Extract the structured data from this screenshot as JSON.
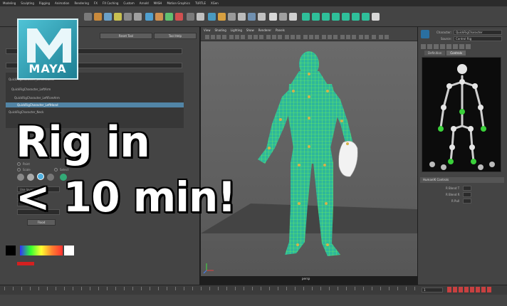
{
  "menu": {
    "items": [
      "Modeling",
      "Sculpting",
      "Rigging",
      "Animation",
      "Rendering",
      "FX",
      "FX Caching",
      "Custom",
      "Arnold",
      "MASH",
      "Motion Graphics",
      "TURTLE",
      "XGen"
    ]
  },
  "logo": {
    "word": "MAYA"
  },
  "overlay": {
    "line1": "Rig in",
    "line2": "< 10 min!"
  },
  "left_panel": {
    "reset_label": "Reset Tool",
    "help_label": "Tool Help",
    "tree": [
      "QuickRigCharacter_LeftShoulder",
      "QuickRigCharacter_LeftArm",
      "QuickRigCharacter_LeftForeArm",
      "QuickRigCharacter_LeftHand",
      "QuickRigCharacter_Neck"
    ],
    "opt_paint": "Paint",
    "opt_scale": "Scale",
    "opt_select": "Select",
    "use_layer": "Use layer",
    "flood_label": "Flood"
  },
  "viewport": {
    "menu": [
      "View",
      "Shading",
      "Lighting",
      "Show",
      "Renderer",
      "Panels"
    ],
    "camera_label": "persp"
  },
  "right_panel": {
    "character_label": "Character:",
    "character_value": "QuickRigCharacter",
    "source_label": "Source:",
    "source_value": "Control Rig",
    "tabs": [
      "Definition",
      "Controls"
    ],
    "section_title": "HumanIK Controls",
    "blend_labels": [
      "R Blend T",
      "R Blend R",
      "R Pull"
    ]
  },
  "timeline": {
    "current_frame": "1"
  },
  "colors": {
    "accent": "#5285a6",
    "mesh_wire": "#7cff4a",
    "mesh_fill": "#2fb89a",
    "joint": "#d6b24a"
  }
}
